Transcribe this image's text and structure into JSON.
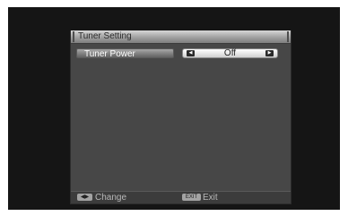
{
  "window": {
    "title": "Tuner Setting"
  },
  "setting": {
    "label": "Tuner Power",
    "value": "Off",
    "left_arrow": "◀",
    "right_arrow": "▶"
  },
  "footer": {
    "change_key": "◀▶",
    "change_label": "Change",
    "exit_key": "EXIT",
    "exit_label": "Exit"
  },
  "icons": {
    "left": "left-arrow-icon",
    "right": "right-arrow-icon"
  }
}
